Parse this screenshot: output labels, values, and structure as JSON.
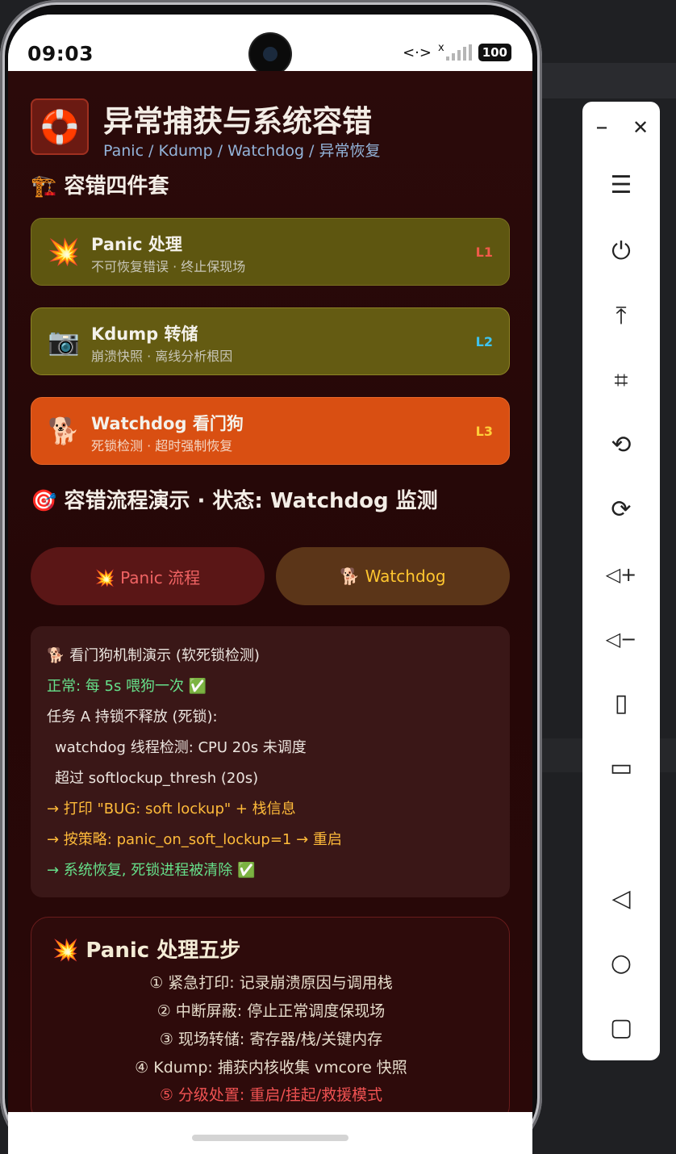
{
  "status_bar": {
    "time": "09:03",
    "net_icon": "<·>",
    "x_mark": "x",
    "battery": "100"
  },
  "header": {
    "logo_icon": "🛟",
    "title": "异常捕获与系统容错",
    "subtitle": "Panic / Kdump / Watchdog / 异常恢复"
  },
  "section1": {
    "icon": "🏗️",
    "title": "容错四件套"
  },
  "cards": [
    {
      "icon": "💥",
      "name": "Panic 处理",
      "desc": "不可恢复错误 · 终止保现场",
      "level": "L1",
      "level_color": "#f05a4a"
    },
    {
      "icon": "📷",
      "name": "Kdump 转储",
      "desc": "崩溃快照 · 离线分析根因",
      "level": "L2",
      "level_color": "#3ec4f0"
    },
    {
      "icon": "🐕",
      "name": "Watchdog 看门狗",
      "desc": "死锁检测 · 超时强制恢复",
      "level": "L3",
      "level_color": "#ffcf3a"
    }
  ],
  "section2": {
    "icon": "🎯",
    "title": "容错流程演示 · 状态: Watchdog 监测"
  },
  "buttons": {
    "panic": "💥 Panic 流程",
    "watchdog": "🐕 Watchdog"
  },
  "log": [
    {
      "text": "🐕 看门狗机制演示 (软死锁检测)",
      "cls": "w"
    },
    {
      "text": "正常: 每 5s 喂狗一次 ✅",
      "cls": "g"
    },
    {
      "text": "任务 A 持锁不释放 (死锁):",
      "cls": "w"
    },
    {
      "text": "watchdog 线程检测: CPU 20s 未调度",
      "cls": "w ind"
    },
    {
      "text": "超过 softlockup_thresh (20s)",
      "cls": "w ind"
    },
    {
      "text": "→ 打印 \"BUG: soft lockup\" + 栈信息",
      "cls": "y"
    },
    {
      "text": "→ 按策略: panic_on_soft_lockup=1 → 重启",
      "cls": "y"
    },
    {
      "text": "→ 系统恢复, 死锁进程被清除 ✅",
      "cls": "g"
    }
  ],
  "steps": {
    "title": "💥 Panic 处理五步",
    "items": [
      "① 紧急打印: 记录崩溃原因与调用栈",
      "② 中断屏蔽: 停止正常调度保现场",
      "③ 现场转储: 寄存器/栈/关键内存",
      "④ Kdump: 捕获内核收集 vmcore 快照",
      "⑤ 分级处置: 重启/挂起/救援模式"
    ]
  },
  "toolbar": {
    "minimize": "–",
    "close": "✕",
    "menu": "☰",
    "power": "⏻",
    "top": "⤒",
    "crop": "⌗",
    "rotate_left": "⟲",
    "rotate_right": "⟳",
    "vol_up": "◁+",
    "vol_down": "◁−",
    "shake": "▯",
    "devices": "▭",
    "back": "◁",
    "home": "○",
    "recent": "▢"
  }
}
